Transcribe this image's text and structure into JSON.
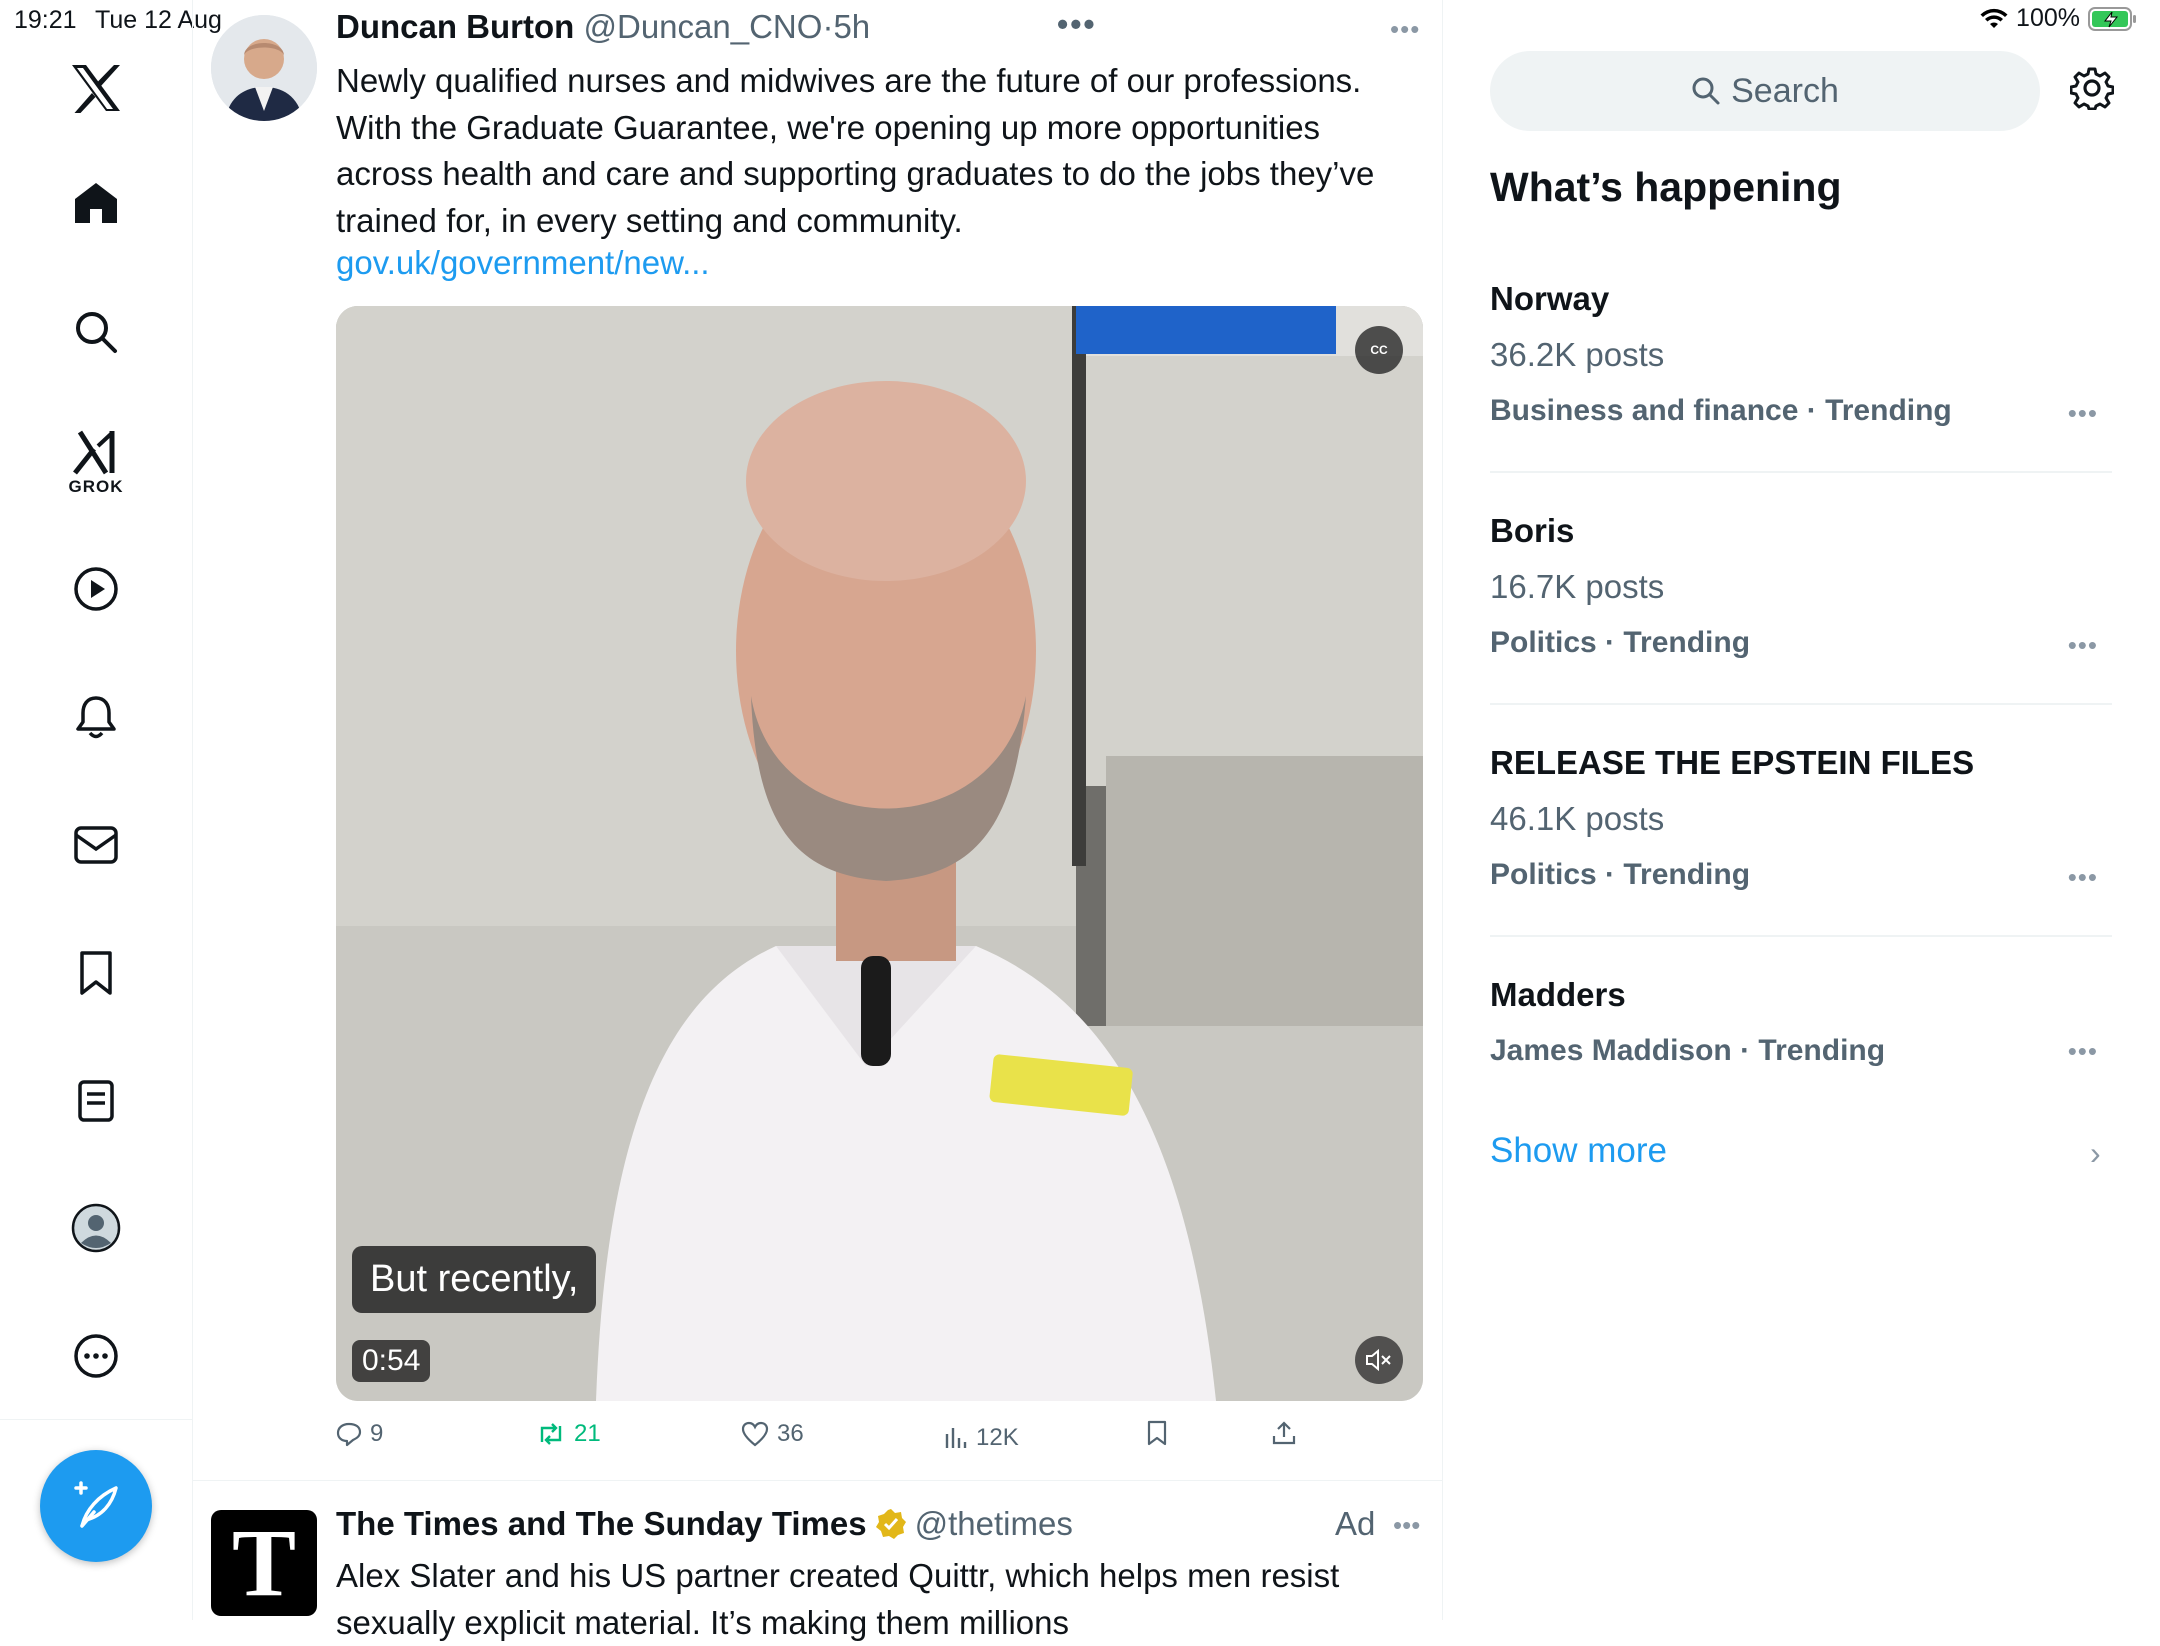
{
  "status_bar": {
    "time": "19:21",
    "date": "Tue 12 Aug",
    "battery": "100%"
  },
  "nav": {
    "grok_label": "GROK",
    "items": [
      "home-icon",
      "search-icon",
      "grok-icon",
      "video-icon",
      "notifications-icon",
      "messages-icon",
      "bookmarks-icon",
      "lists-icon",
      "profile-icon",
      "more-icon"
    ]
  },
  "tweet": {
    "name": "Duncan Burton",
    "handle": "@Duncan_CNO",
    "separator": "·",
    "time": "5h",
    "text": "Newly qualified nurses and midwives are the future of our professions. With the Graduate Guarantee, we're opening up more opportunities across health and care and supporting graduates to do the jobs they’ve trained for, in every setting and community.",
    "link": "gov.uk/government/new...",
    "video": {
      "caption": "But recently,",
      "duration": "0:54",
      "cc_label": "CC"
    },
    "stats": {
      "replies": "9",
      "retweets": "21",
      "likes": "36",
      "views": "12K"
    }
  },
  "ad": {
    "avatar_letter": "T",
    "name": "The Times and The Sunday Times",
    "handle": "@thetimes",
    "label": "Ad",
    "text": "Alex Slater and his US partner created Quittr, which helps men resist sexually explicit material. It’s making them millions"
  },
  "sidebar": {
    "search_placeholder": "Search",
    "heading": "What’s happening",
    "trends": [
      {
        "title": "Norway",
        "posts": "36.2K posts",
        "category": "Business and finance · Trending"
      },
      {
        "title": "Boris",
        "posts": "16.7K posts",
        "category": "Politics · Trending"
      },
      {
        "title": "RELEASE THE EPSTEIN FILES",
        "posts": "46.1K posts",
        "category": "Politics · Trending"
      },
      {
        "title": "Madders",
        "posts": "",
        "category": "James Maddison · Trending"
      }
    ],
    "show_more": "Show more"
  },
  "colors": {
    "accent": "#1d9bf0",
    "retweet_green": "#00ba7c",
    "muted": "#536471",
    "verified_gold": "#e2b719"
  }
}
